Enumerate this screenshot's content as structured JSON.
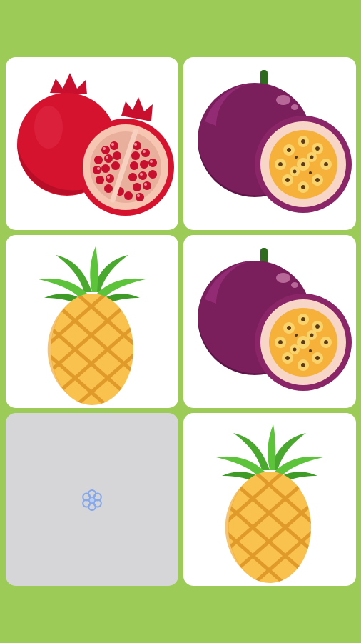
{
  "game": {
    "cards": [
      {
        "state": "face-up",
        "fruit": "pomegranate-icon"
      },
      {
        "state": "face-up",
        "fruit": "passion-fruit-icon"
      },
      {
        "state": "face-up",
        "fruit": "pineapple-icon"
      },
      {
        "state": "face-up",
        "fruit": "passion-fruit-icon"
      },
      {
        "state": "face-down",
        "fruit": "flower-icon"
      },
      {
        "state": "face-up",
        "fruit": "pineapple-icon"
      }
    ]
  },
  "colors": {
    "background": "#9ccb58",
    "card_face": "#ffffff",
    "card_back": "#d6d6d8",
    "card_back_icon": "#86a8ea"
  }
}
